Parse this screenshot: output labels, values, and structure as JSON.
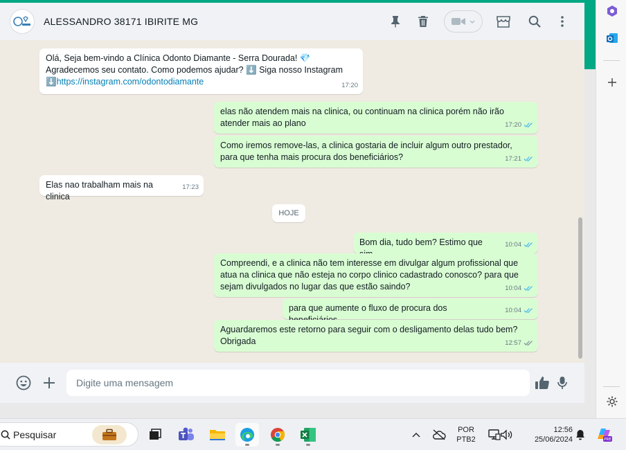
{
  "header": {
    "contact_name": "ALESSANDRO 38171 IBIRITE MG",
    "avatar_text": "Odonto"
  },
  "messages": [
    {
      "dir": "in",
      "text_line1": "Olá, Seja bem-vindo a Clínica Odonto Diamante - Serra Dourada! 💎",
      "text_line2": "Agradecemos seu contato. Como podemos ajudar? ⬇️ Siga nosso Instagram",
      "link": "https://instagram.com/odontodiamante",
      "link_prefix": "⬇️",
      "time": "17:20"
    },
    {
      "dir": "out",
      "text": "elas não atendem mais na clinica, ou continuam na clinica porém não irão\natender mais ao plano",
      "time": "17:20"
    },
    {
      "dir": "out",
      "text": "Como iremos remove-las, a clinica gostaria de incluir algum outro prestador,\npara que tenha mais procura dos beneficiários?",
      "time": "17:21"
    },
    {
      "dir": "in",
      "text": "Elas nao trabalham mais na clinica",
      "time": "17:23"
    },
    {
      "dir": "out",
      "text": "Bom dia, tudo bem? Estimo que sim.",
      "time": "10:04"
    },
    {
      "dir": "out",
      "text": "Compreendi, e a clinica não tem interesse em divulgar algum profissional que\natua na clinica que não esteja no corpo clinico cadastrado conosco? para que\nsejam divulgados no lugar das que estão saindo?",
      "time": "10:04"
    },
    {
      "dir": "out",
      "text": "para que aumente o fluxo de procura dos beneficiários",
      "time": "10:04"
    },
    {
      "dir": "out",
      "text": "Aguardaremos este retorno para seguir com o desligamento delas tudo bem?\nObrigada",
      "time": "12:57"
    }
  ],
  "day_label": "HOJE",
  "composer": {
    "placeholder": "Digite uma mensagem"
  },
  "taskbar": {
    "search_label": "Pesquisar",
    "language_line1": "POR",
    "language_line2": "PTB2",
    "clock_time": "12:56",
    "clock_date": "25/06/2024"
  },
  "colors": {
    "accent": "#00a884",
    "outgoing_bubble": "#d9fdd3",
    "incoming_bubble": "#ffffff",
    "chat_background": "#efeae2",
    "read_ticks": "#53bdeb",
    "link": "#027eb5"
  },
  "icons": [
    "pin-icon",
    "trash-icon",
    "video-call-icon",
    "shop-icon",
    "search-icon",
    "menu-dots-icon",
    "emoji-icon",
    "plus-icon",
    "thumbs-up-icon",
    "microphone-icon",
    "double-check-icon"
  ]
}
